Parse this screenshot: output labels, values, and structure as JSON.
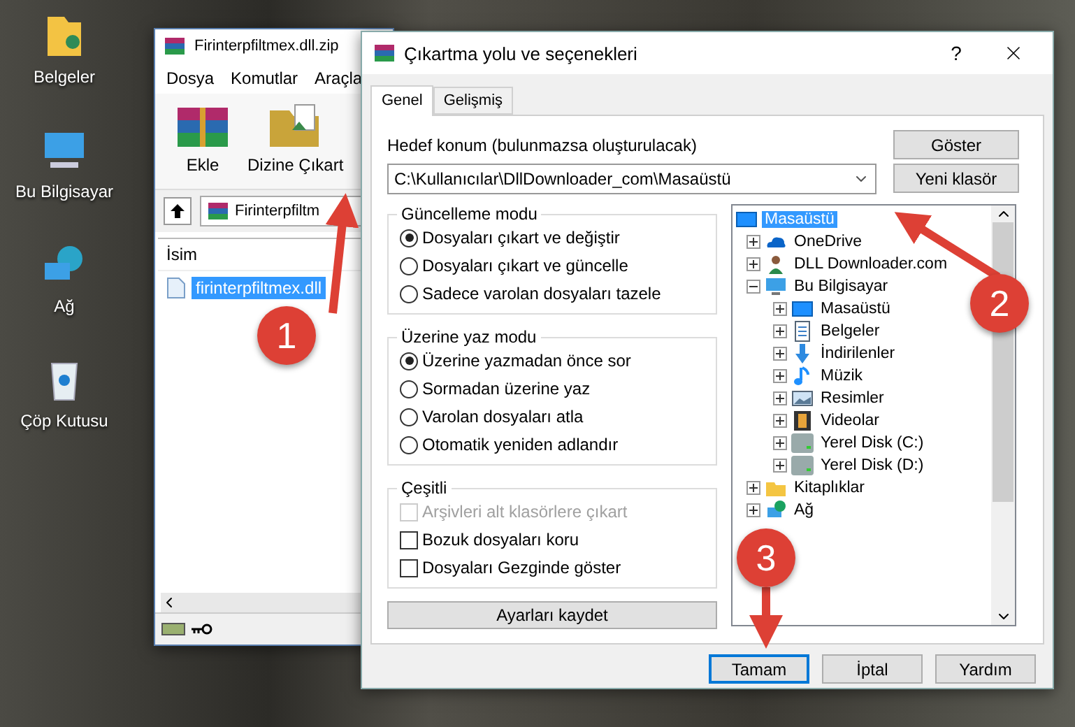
{
  "desktop_icons": [
    {
      "label": "Belgeler",
      "kind": "documents"
    },
    {
      "label": "Bu Bilgisayar",
      "kind": "computer"
    },
    {
      "label": "Ağ",
      "kind": "network"
    },
    {
      "label": "Çöp Kutusu",
      "kind": "recycle"
    }
  ],
  "archive_window": {
    "title": "Firinterpfiltmex.dll.zip",
    "menu": [
      "Dosya",
      "Komutlar",
      "Araçla"
    ],
    "toolbar": [
      {
        "label": "Ekle",
        "kind": "add"
      },
      {
        "label": "Dizine Çıkart",
        "kind": "extract"
      }
    ],
    "address": "Firinterpfiltm",
    "column": "İsim",
    "files": [
      {
        "name": "firinterpfiltmex.dll",
        "selected": true
      }
    ]
  },
  "dialog": {
    "title": "Çıkartma yolu ve seçenekleri",
    "help": "?",
    "tabs": [
      {
        "label": "Genel",
        "selected": true
      },
      {
        "label": "Gelişmiş",
        "selected": false
      }
    ],
    "destination_label": "Hedef konum (bulunmazsa oluşturulacak)",
    "destination_path": "C:\\Kullanıcılar\\DllDownloader_com\\Masaüstü",
    "side_buttons": [
      "Göster",
      "Yeni klasör"
    ],
    "update_mode": {
      "title": "Güncelleme modu",
      "options": [
        {
          "label": "Dosyaları çıkart ve değiştir",
          "selected": true
        },
        {
          "label": "Dosyaları çıkart ve güncelle",
          "selected": false
        },
        {
          "label": "Sadece varolan dosyaları tazele",
          "selected": false
        }
      ]
    },
    "overwrite_mode": {
      "title": "Üzerine yaz modu",
      "options": [
        {
          "label": "Üzerine yazmadan önce sor",
          "selected": true
        },
        {
          "label": "Sormadan üzerine yaz",
          "selected": false
        },
        {
          "label": "Varolan dosyaları atla",
          "selected": false
        },
        {
          "label": "Otomatik yeniden adlandır",
          "selected": false
        }
      ]
    },
    "misc": {
      "title": "Çeşitli",
      "options": [
        {
          "label": "Arşivleri alt klasörlere çıkart",
          "checked": false,
          "disabled": true
        },
        {
          "label": "Bozuk dosyaları koru",
          "checked": false,
          "disabled": false
        },
        {
          "label": "Dosyaları Gezginde göster",
          "checked": false,
          "disabled": false
        }
      ]
    },
    "save_button": "Ayarları kaydet",
    "tree": [
      {
        "label": "Masaüstü",
        "kind": "desktop",
        "selected": true,
        "children": [
          {
            "label": "OneDrive",
            "kind": "cloud",
            "selected": false,
            "expanded": false
          },
          {
            "label": "DLL Downloader.com",
            "kind": "user",
            "selected": false,
            "expanded": false
          },
          {
            "label": "Bu Bilgisayar",
            "kind": "computer",
            "selected": false,
            "expanded": true,
            "children": [
              {
                "label": "Masaüstü",
                "kind": "desktop",
                "selected": false,
                "expanded": false
              },
              {
                "label": "Belgeler",
                "kind": "documents",
                "selected": false,
                "expanded": false
              },
              {
                "label": "İndirilenler",
                "kind": "downloads",
                "selected": false,
                "expanded": false
              },
              {
                "label": "Müzik",
                "kind": "music",
                "selected": false,
                "expanded": false
              },
              {
                "label": "Resimler",
                "kind": "pictures",
                "selected": false,
                "expanded": false
              },
              {
                "label": "Videolar",
                "kind": "videos",
                "selected": false,
                "expanded": false
              },
              {
                "label": "Yerel Disk (C:)",
                "kind": "drive",
                "selected": false,
                "expanded": false
              },
              {
                "label": "Yerel Disk (D:)",
                "kind": "drive",
                "selected": false,
                "expanded": false
              }
            ]
          },
          {
            "label": "Kitaplıklar",
            "kind": "library",
            "selected": false,
            "expanded": false
          },
          {
            "label": "Ağ",
            "kind": "network",
            "selected": false,
            "expanded": false
          }
        ]
      }
    ],
    "buttons": [
      {
        "label": "Tamam",
        "focused": true
      },
      {
        "label": "İptal",
        "focused": false
      },
      {
        "label": "Yardım",
        "focused": false
      }
    ]
  },
  "annotations": [
    {
      "number": "1"
    },
    {
      "number": "2"
    },
    {
      "number": "3"
    }
  ]
}
